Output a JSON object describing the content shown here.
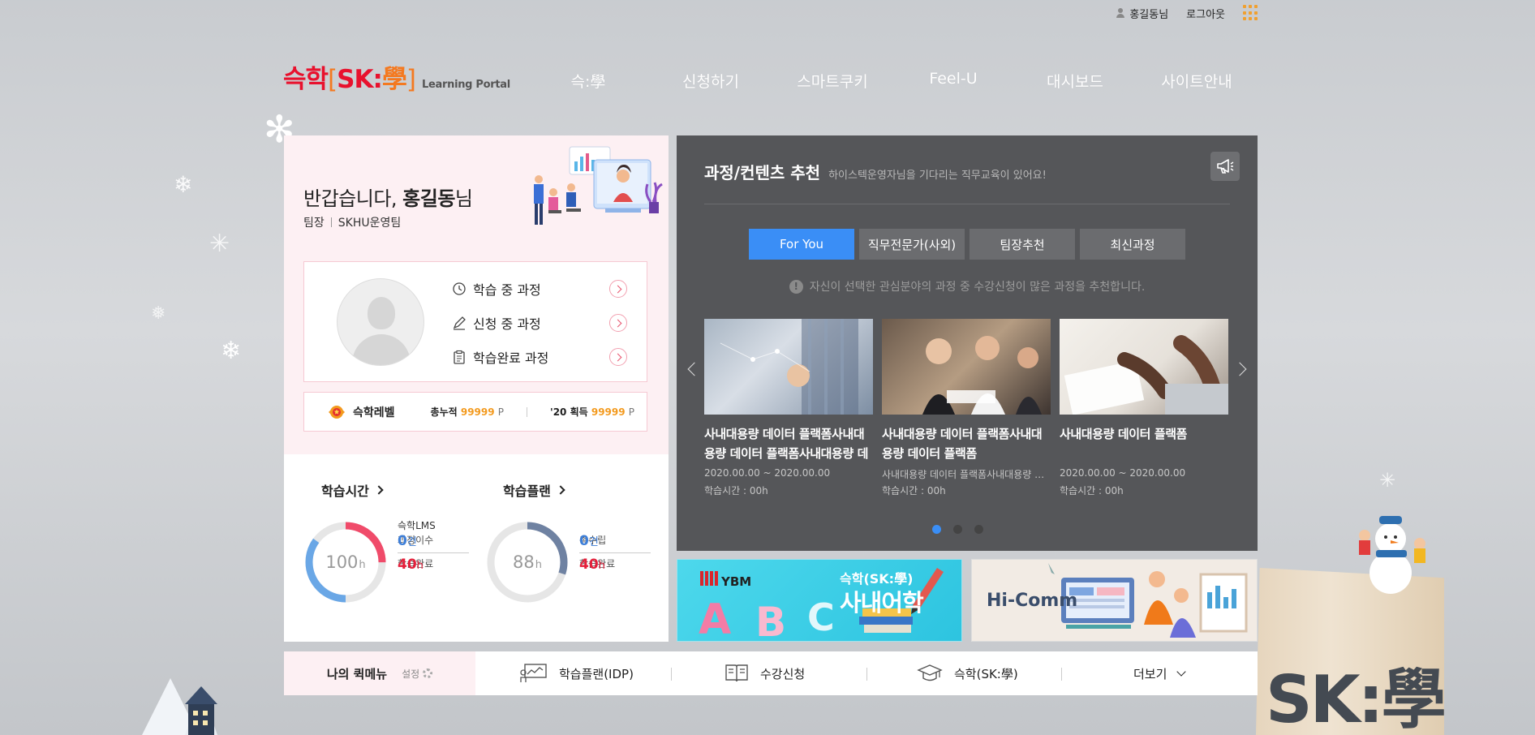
{
  "util": {
    "user_name": "홍길동님",
    "logout": "로그아웃"
  },
  "logo": {
    "part1": "슥학",
    "bracket_open": "[",
    "sk": "SK",
    "colon": ":",
    "hak": "學",
    "bracket_close": "]",
    "sub": "Learning Portal"
  },
  "gnb": [
    "슥:學",
    "신청하기",
    "스마트쿠키",
    "Feel-U",
    "대시보드",
    "사이트안내"
  ],
  "profile": {
    "greeting_prefix": "반갑습니다, ",
    "name": "홍길동",
    "suffix": "님",
    "role": "팀장",
    "team": "SKHU운영팀",
    "links": [
      "학습 중 과정",
      "신청 중 과정",
      "학습완료 과정"
    ]
  },
  "level": {
    "label": "슥학레벨",
    "total_label": "총누적",
    "total_value": "99999",
    "unit": "P",
    "year_label": "'20 획득",
    "year_value": "99999"
  },
  "study_time": {
    "title": "학습시간",
    "center_value": "100",
    "center_unit": "h",
    "source": "슥학LMS",
    "course_count": "0",
    "course_unit": "건",
    "course_label": "과정이수",
    "done_value": "40",
    "done_unit": "h",
    "done_label": "학습완료",
    "progress": 0.6
  },
  "study_plan": {
    "title": "학습플랜",
    "center_value": "88",
    "center_unit": "h",
    "plan_count": "0",
    "plan_unit": "건",
    "plan_label": "총수립",
    "done_value": "40",
    "done_unit": "h",
    "done_label": "학습완료",
    "progress": 0.3
  },
  "recommend": {
    "title": "과정/컨텐츠 추천",
    "desc": "하이스텍운영자님을 기다리는 직무교육이 있어요!",
    "tabs": [
      "For You",
      "직무전문가(사외)",
      "팀장추천",
      "최신과정"
    ],
    "active_tab": 0,
    "notice": "자신이 선택한 관심분야의 과정 중 수강신청이 많은 과정을 추천합니다.",
    "cards": [
      {
        "title": "사내대용량 데이터 플랙폼사내대용량 데이터 플랙폼사내대용량 데이터 플랙폼",
        "sub": "2020.00.00 ~ 2020.00.00",
        "time": "학습시간 : 00h"
      },
      {
        "title": "사내대용량 데이터 플랙폼사내대용량 데이터 플랙폼",
        "sub": "사내대용량 데이터 플랙폼사내대용량 데이터 플랙폼",
        "time": "학습시간 : 00h"
      },
      {
        "title": "사내대용량 데이터 플랙폼",
        "sub": "2020.00.00 ~ 2020.00.00",
        "time": "학습시간 : 00h"
      }
    ],
    "page_count": 3,
    "active_page": 0
  },
  "banners": {
    "ybm": {
      "brand": "YBM",
      "line1": "슥학(SK:學)",
      "line2": "사내어학",
      "letters": [
        "A",
        "B",
        "C"
      ]
    },
    "hicomm": {
      "title": "Hi-Comm"
    }
  },
  "quick": {
    "title": "나의 퀵메뉴",
    "setting": "설정",
    "items": [
      "학습플랜(IDP)",
      "수강신청",
      "슥학(SK:學)"
    ],
    "more": "더보기"
  },
  "decor": {
    "sk_big": "SK:學"
  },
  "colors": {
    "accent_blue": "#3a8ef6",
    "accent_red": "#e41f3a",
    "accent_orange": "#f39a1e",
    "panel_dark": "#555659"
  }
}
